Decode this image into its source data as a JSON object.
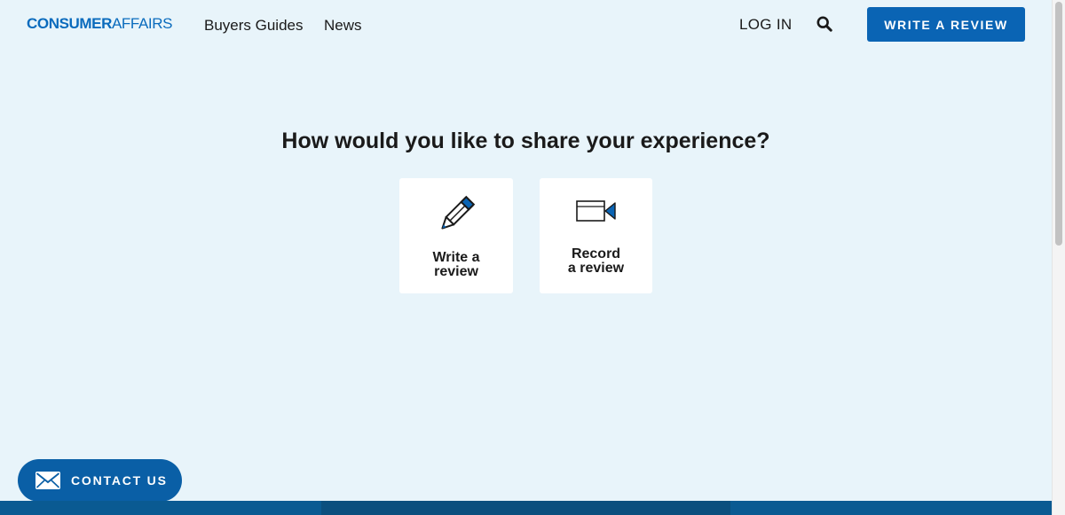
{
  "header": {
    "logo": {
      "part1": "CONSUMER",
      "part2": "AFFAIRS"
    },
    "nav": [
      {
        "label": "Buyers Guides"
      },
      {
        "label": "News"
      }
    ],
    "login_label": "LOG IN",
    "search_icon": "search-icon",
    "write_review_label": "WRITE A REVIEW"
  },
  "main": {
    "heading": "How would you like to share your experience?",
    "options": [
      {
        "label": "Write a review",
        "icon": "pencil-icon"
      },
      {
        "label": "Record a review",
        "icon": "video-camera-icon"
      }
    ]
  },
  "contact": {
    "label": "CONTACT US",
    "icon": "mail-icon"
  },
  "colors": {
    "background": "#e8f4fa",
    "brand_blue": "#0a64b4",
    "contact_blue": "#0a5fa6",
    "footer_segments": [
      "#0a5a92",
      "#0b4f7e",
      "#0a5a92"
    ]
  }
}
